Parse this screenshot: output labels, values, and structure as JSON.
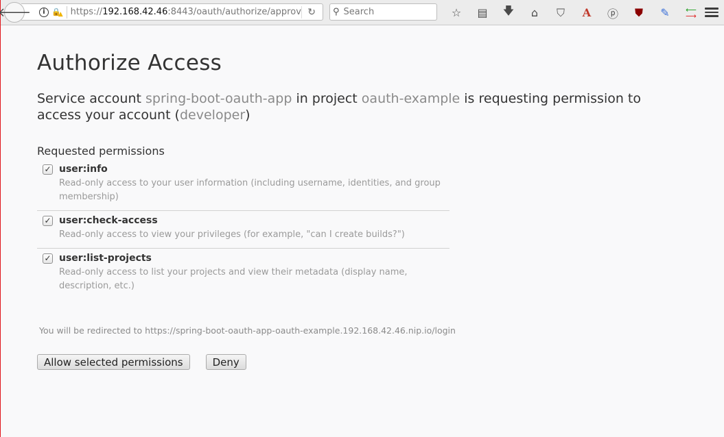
{
  "browser": {
    "url_scheme": "https://",
    "url_host": "192.168.42.46",
    "url_rest": ":8443/oauth/authorize/approv",
    "search_placeholder": "Search",
    "toolbar_icons": [
      "star-icon",
      "reading-list-icon",
      "download-icon",
      "home-icon",
      "pocket-icon",
      "font-a-icon",
      "p-extension-icon",
      "ublock-icon",
      "eyedropper-icon",
      "arrows-icon"
    ],
    "accent_red": "#e0161b"
  },
  "page": {
    "title": "Authorize Access",
    "intro": {
      "t1": "Service account ",
      "account": "spring-boot-oauth-app",
      "t2": " in project ",
      "project": "oauth-example",
      "t3": " is requesting permission to access your account (",
      "user": "developer",
      "t4": ")"
    },
    "requested_label": "Requested permissions",
    "permissions": [
      {
        "name": "user:info",
        "checked": true,
        "desc": "Read-only access to your user information (including username, identities, and group membership)"
      },
      {
        "name": "user:check-access",
        "checked": true,
        "desc": "Read-only access to view your privileges (for example, \"can I create builds?\")"
      },
      {
        "name": "user:list-projects",
        "checked": true,
        "desc": "Read-only access to list your projects and view their metadata (display name, description, etc.)"
      }
    ],
    "redirect": "You will be redirected to https://spring-boot-oauth-app-oauth-example.192.168.42.46.nip.io/login",
    "allow_label": "Allow selected permissions",
    "deny_label": "Deny"
  }
}
